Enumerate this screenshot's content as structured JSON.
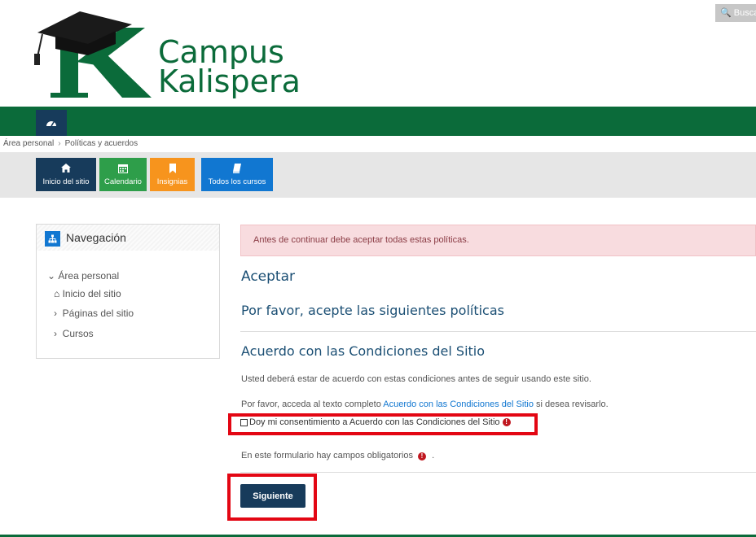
{
  "header": {
    "brand_line1": "Campus",
    "brand_line2": "Kalispera",
    "search_label": "Busca"
  },
  "breadcrumb": [
    "Área personal",
    "Políticas y acuerdos"
  ],
  "quick_links": [
    {
      "label": "Inicio del sitio",
      "color": "#173b5b",
      "icon": "home-icon"
    },
    {
      "label": "Calendario",
      "color": "#2e9e4a",
      "icon": "calendar-icon"
    },
    {
      "label": "Insignias",
      "color": "#f7941d",
      "icon": "bookmark-icon"
    },
    {
      "label": "Todos los cursos",
      "color": "#1177d1",
      "icon": "book-icon"
    }
  ],
  "navigation": {
    "title": "Navegación",
    "items": [
      {
        "label": "Área personal",
        "icon": "chevron-down-icon"
      },
      {
        "label": "Inicio del sitio",
        "icon": "home-icon"
      },
      {
        "label": "Páginas del sitio",
        "icon": "chevron-right-icon"
      },
      {
        "label": "Cursos",
        "icon": "chevron-right-icon"
      }
    ]
  },
  "main": {
    "alert": "Antes de continuar debe aceptar todas estas políticas.",
    "heading": "Aceptar",
    "subheading": "Por favor, acepte las siguientes políticas",
    "policy_title": "Acuerdo con las Condiciones del Sitio",
    "policy_text": "Usted deberá estar de acuerdo con estas condiciones antes de seguir usando este sitio.",
    "full_text_prefix": "Por favor, acceda al texto completo",
    "full_text_link": "Acuerdo con las Condiciones del Sitio",
    "full_text_suffix": "si desea revisarlo.",
    "consent_label": "Doy mi consentimiento a Acuerdo con las Condiciones del Sitio",
    "consent_checked": false,
    "required_note": "En este formulario hay campos obligatorios",
    "required_note_end": ".",
    "next_button": "Siguiente"
  },
  "colors": {
    "brand_green": "#0b6b3a",
    "dark_blue": "#173b5b",
    "highlight_red": "#e30613"
  }
}
